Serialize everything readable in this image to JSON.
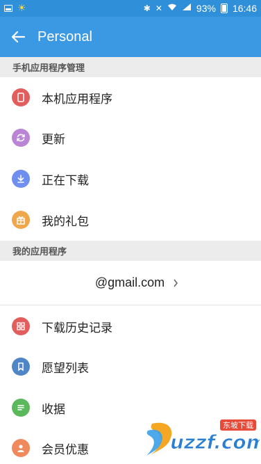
{
  "status_bar": {
    "battery": "93%",
    "time": "16:46"
  },
  "app_bar": {
    "title": "Personal"
  },
  "sections": {
    "phone_apps_header": "手机应用程序管理",
    "my_apps_header": "我的应用程序"
  },
  "phone_apps": [
    {
      "label": "本机应用程序",
      "icon": "phone-icon",
      "color": "#e35d5d"
    },
    {
      "label": "更新",
      "icon": "refresh-icon",
      "color": "#bb85d6"
    },
    {
      "label": "正在下载",
      "icon": "download-icon",
      "color": "#6f8ff0"
    },
    {
      "label": "我的礼包",
      "icon": "gift-icon",
      "color": "#f0a64a"
    }
  ],
  "account": {
    "email": "@gmail.com"
  },
  "my_apps": [
    {
      "label": "下载历史记录",
      "icon": "grid-icon",
      "color": "#e35d5d"
    },
    {
      "label": "愿望列表",
      "icon": "bookmark-icon",
      "color": "#4f86c6"
    },
    {
      "label": "收据",
      "icon": "receipt-icon",
      "color": "#5cb85c"
    },
    {
      "label": "会员优惠",
      "icon": "person-icon",
      "color": "#f08a5d"
    }
  ],
  "watermark": {
    "text": "uzzf.com",
    "badge": "东坡下载"
  }
}
